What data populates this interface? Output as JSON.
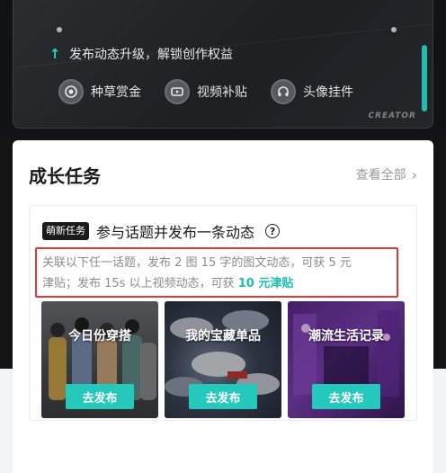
{
  "banner": {
    "upgrade_text": "发布动态升级，解锁创作权益",
    "perks": [
      {
        "label": "种草赏金",
        "icon": "coin-icon"
      },
      {
        "label": "视频补贴",
        "icon": "video-icon"
      },
      {
        "label": "头像挂件",
        "icon": "headphone-icon"
      }
    ],
    "watermark": "CREATOR",
    "accent": "#1fd8c8"
  },
  "growth": {
    "title": "成长任务",
    "view_all": "查看全部",
    "task": {
      "tag": "萌新任务",
      "title": "参与话题并发布一条动态",
      "help": "?",
      "desc_line1": "关联以下任一话题，发布 2 图 15 字的图文动态，可获 5 元",
      "desc_line2_prefix": "津贴；发布 15s 以上视频动态，可获 ",
      "desc_line2_highlight": "10 元津贴",
      "highlight_color": "#1abfb1",
      "border_color": "#e23a35"
    },
    "topics": [
      {
        "name": "今日份穿搭",
        "button": "去发布"
      },
      {
        "name": "我的宝藏单品",
        "button": "去发布"
      },
      {
        "name": "潮流生活记录",
        "button": "去发布"
      }
    ],
    "button_color": "#24c9bb"
  }
}
